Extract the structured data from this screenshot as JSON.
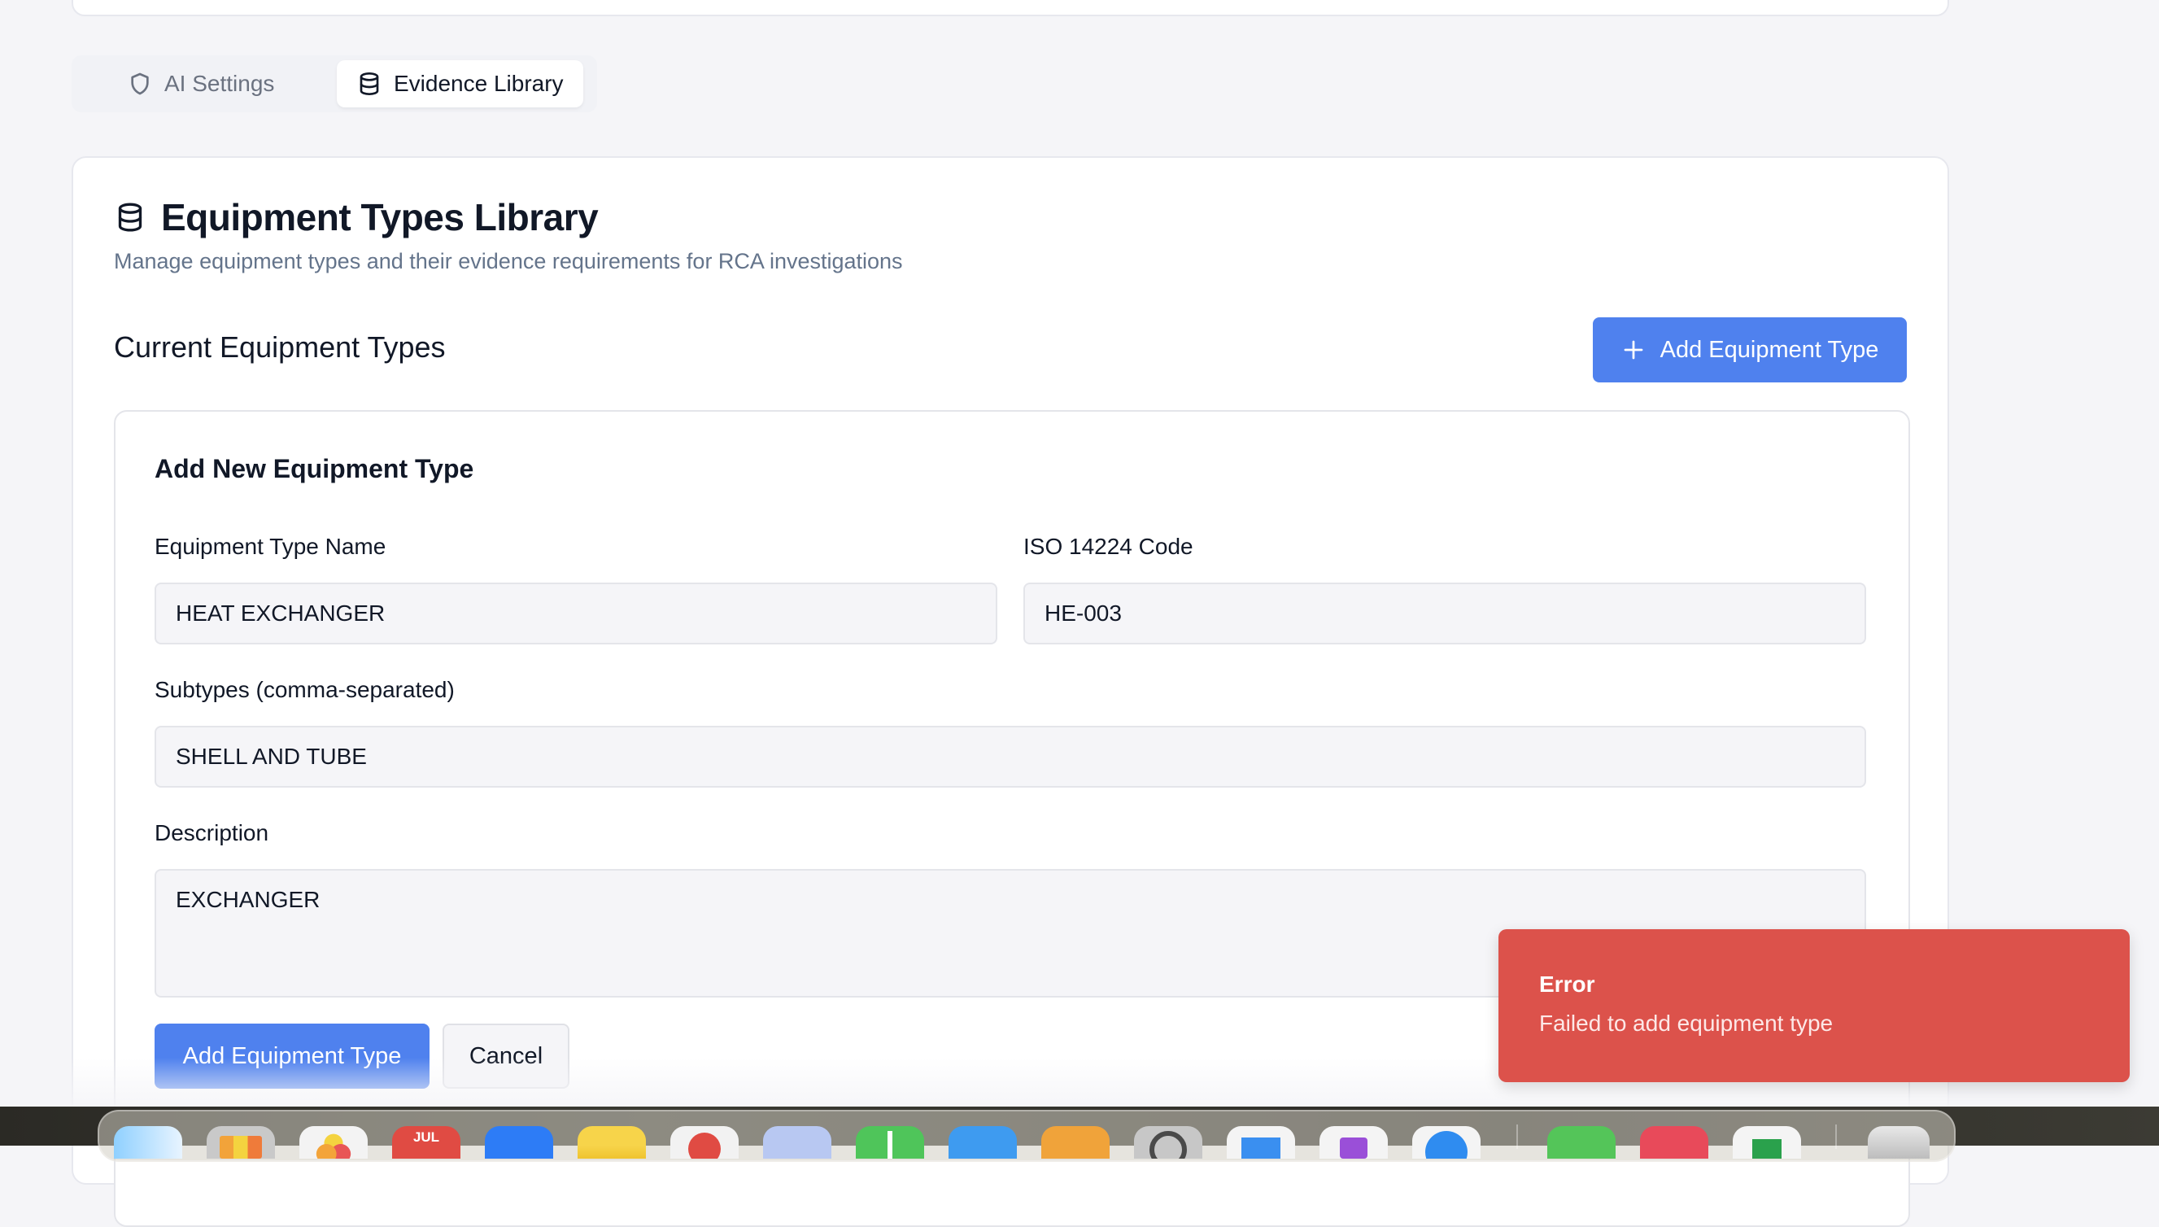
{
  "tabs": [
    {
      "label": "AI Settings",
      "icon": "shield-icon",
      "active": false
    },
    {
      "label": "Evidence Library",
      "icon": "database-icon",
      "active": true
    }
  ],
  "header": {
    "title": "Equipment Types Library",
    "subtitle": "Manage equipment types and their evidence requirements for RCA investigations",
    "icon": "database-icon"
  },
  "section": {
    "title": "Current Equipment Types",
    "add_button_label": "Add Equipment Type",
    "add_button_icon": "plus-icon"
  },
  "form": {
    "title": "Add New Equipment Type",
    "name_label": "Equipment Type Name",
    "name_value": "HEAT EXCHANGER",
    "iso_label": "ISO 14224 Code",
    "iso_value": "HE-003",
    "subtypes_label": "Subtypes (comma-separated)",
    "subtypes_value": "SHELL AND TUBE",
    "description_label": "Description",
    "description_value": "EXCHANGER",
    "submit_label": "Add Equipment Type",
    "cancel_label": "Cancel"
  },
  "toast": {
    "title": "Error",
    "message": "Failed to add equipment type",
    "color": "#dc524b"
  },
  "dock": {
    "calendar_month": "JUL"
  },
  "colors": {
    "accent": "#4f81ee",
    "muted_text": "#64748b",
    "background": "#f5f5f8"
  }
}
